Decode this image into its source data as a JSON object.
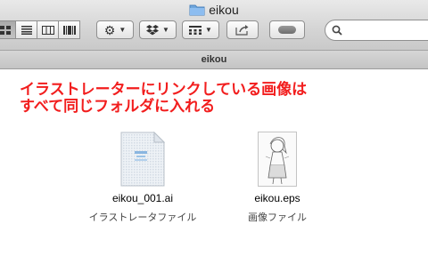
{
  "window": {
    "title": "eikou",
    "path": "eikou"
  },
  "toolbar": {
    "view_modes": [
      "icon-view",
      "list-view",
      "column-view",
      "coverflow-view"
    ],
    "active_view": "icon-view",
    "action_menu": "gear-icon",
    "dropbox_menu": "dropbox-icon",
    "arrange_menu": "arrange-grid-icon",
    "share": "share-icon",
    "tags": "tag-icon",
    "search_placeholder": ""
  },
  "annotation": {
    "line1": "イラストレーターにリンクしている画像は",
    "line2": "すべて同じフォルダに入れる"
  },
  "files": [
    {
      "name": "eikou_001.ai",
      "kind": "イラストレータファイル"
    },
    {
      "name": "eikou.eps",
      "kind": "画像ファイル"
    }
  ],
  "colors": {
    "annotation": "#f21d1d"
  }
}
